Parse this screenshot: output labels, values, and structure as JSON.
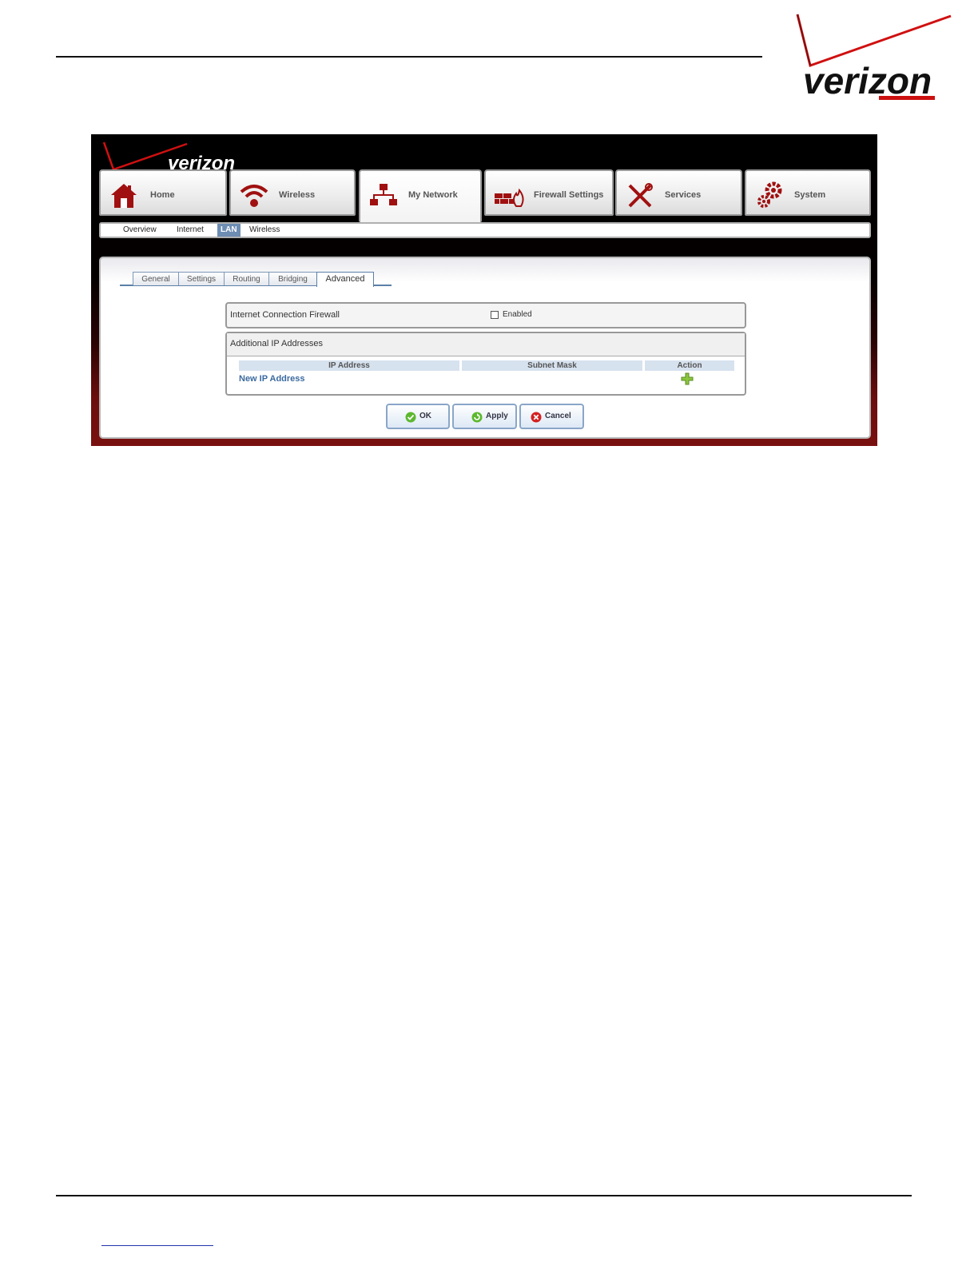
{
  "document": {
    "logo_text": "verizon"
  },
  "app": {
    "logo_text": "verizon",
    "main_tabs": [
      {
        "label": "Home",
        "icon": "home-icon"
      },
      {
        "label": "Wireless",
        "icon": "wifi-icon"
      },
      {
        "label": "My Network",
        "icon": "network-icon",
        "active": true
      },
      {
        "label": "Firewall Settings",
        "icon": "firewall-icon"
      },
      {
        "label": "Services",
        "icon": "tools-icon"
      },
      {
        "label": "System",
        "icon": "gears-icon"
      }
    ],
    "sub_nav": [
      {
        "label": "Overview"
      },
      {
        "label": "Internet"
      },
      {
        "label": "LAN",
        "active": true
      },
      {
        "label": "Wireless"
      }
    ],
    "tabs": [
      {
        "label": "General"
      },
      {
        "label": "Settings"
      },
      {
        "label": "Routing"
      },
      {
        "label": "Bridging"
      },
      {
        "label": "Advanced",
        "active": true
      }
    ],
    "firewall": {
      "title": "Internet Connection Firewall",
      "enabled_label": "Enabled",
      "enabled": false
    },
    "additional_ip": {
      "title": "Additional IP Addresses",
      "columns": [
        "IP Address",
        "Subnet Mask",
        "Action"
      ],
      "new_link": "New IP Address"
    },
    "buttons": {
      "ok": "OK",
      "apply": "Apply",
      "cancel": "Cancel"
    },
    "colors": {
      "brand_red": "#cc0000",
      "icon_red": "#a01010",
      "tab_blue": "#5c7fa8",
      "active_subnav": "#6d8db3",
      "link_blue": "#3b6aa0"
    }
  }
}
